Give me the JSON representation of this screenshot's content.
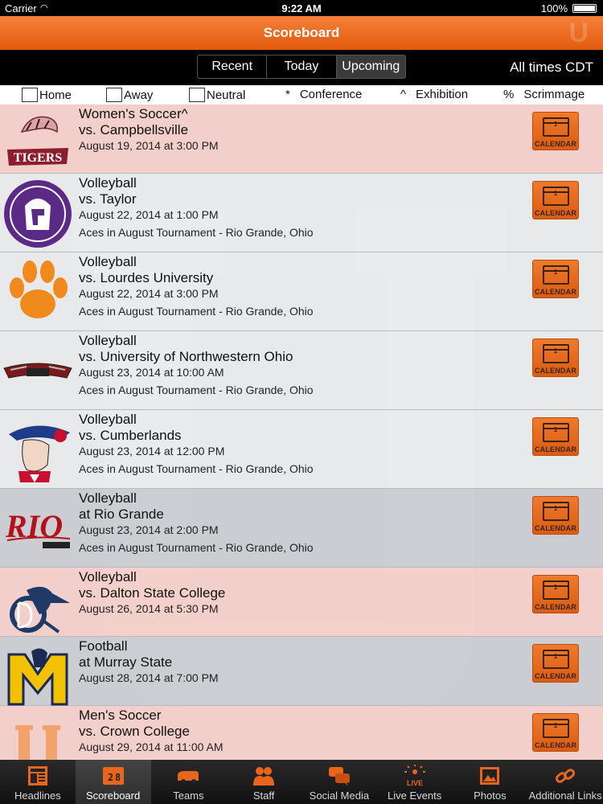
{
  "status": {
    "carrier": "Carrier",
    "time": "9:22 AM",
    "battery": "100%"
  },
  "title": "Scoreboard",
  "segments": [
    {
      "label": "Recent",
      "active": false
    },
    {
      "label": "Today",
      "active": false
    },
    {
      "label": "Upcoming",
      "active": true
    }
  ],
  "all_times": "All times CDT",
  "filters": {
    "home": "Home",
    "away": "Away",
    "neutral": "Neutral"
  },
  "legend": [
    {
      "symbol": "*",
      "label": "Conference"
    },
    {
      "symbol": "^",
      "label": "Exhibition"
    },
    {
      "symbol": "%",
      "label": "Scrimmage"
    }
  ],
  "events": [
    {
      "sport": "Women's Soccer^",
      "opponent": "vs. Campbellsville",
      "date": "August 19, 2014 at 3:00 PM",
      "tournament": "",
      "logo": "tigers-logo"
    },
    {
      "sport": "Volleyball",
      "opponent": "vs. Taylor",
      "date": "August 22, 2014 at 1:00 PM",
      "tournament": "Aces in August Tournament - Rio Grande, Ohio",
      "logo": "trojan-logo"
    },
    {
      "sport": "Volleyball",
      "opponent": "vs. Lourdes University",
      "date": "August 22, 2014 at 3:00 PM",
      "tournament": "Aces in August Tournament - Rio Grande, Ohio",
      "logo": "paw-logo"
    },
    {
      "sport": "Volleyball",
      "opponent": "vs. University of Northwestern Ohio",
      "date": "August 23, 2014 at 10:00 AM",
      "tournament": "Aces in August Tournament - Rio Grande, Ohio",
      "logo": "racers-logo"
    },
    {
      "sport": "Volleyball",
      "opponent": "vs. Cumberlands",
      "date": "August 23, 2014 at 12:00 PM",
      "tournament": "Aces in August Tournament - Rio Grande, Ohio",
      "logo": "patriot-logo"
    },
    {
      "sport": "Volleyball",
      "opponent": "at Rio Grande",
      "date": "August 23, 2014 at 2:00 PM",
      "tournament": "Aces in August Tournament - Rio Grande, Ohio",
      "logo": "rio-logo"
    },
    {
      "sport": "Volleyball",
      "opponent": "vs. Dalton State College",
      "date": "August 26, 2014 at 5:30 PM",
      "tournament": "",
      "logo": "dc-roadrunner-logo"
    },
    {
      "sport": "Football",
      "opponent": "at Murray State",
      "date": "August 28, 2014 at 7:00 PM",
      "tournament": "",
      "logo": "murray-state-logo"
    },
    {
      "sport": "Men's Soccer",
      "opponent": "vs. Crown College",
      "date": "August 29, 2014 at 11:00 AM",
      "tournament": "",
      "logo": "u-logo"
    }
  ],
  "calendar_label": "CALENDAR",
  "calendar_day": "1",
  "tabs": [
    {
      "label": "Headlines",
      "icon": "newspaper-icon",
      "active": false
    },
    {
      "label": "Scoreboard",
      "icon": "scoreboard-icon",
      "active": true
    },
    {
      "label": "Teams",
      "icon": "team-bus-icon",
      "active": false
    },
    {
      "label": "Staff",
      "icon": "people-icon",
      "active": false
    },
    {
      "label": "Social Media",
      "icon": "chat-bubbles-icon",
      "active": false
    },
    {
      "label": "Live Events",
      "icon": "live-icon",
      "active": false
    },
    {
      "label": "Photos",
      "icon": "photo-icon",
      "active": false
    },
    {
      "label": "Additional Links",
      "icon": "link-icon",
      "active": false
    }
  ],
  "colors": {
    "accent": "#e8661c",
    "calendar_ink": "#3b2313",
    "tab_bg": "#1c1c1c"
  }
}
